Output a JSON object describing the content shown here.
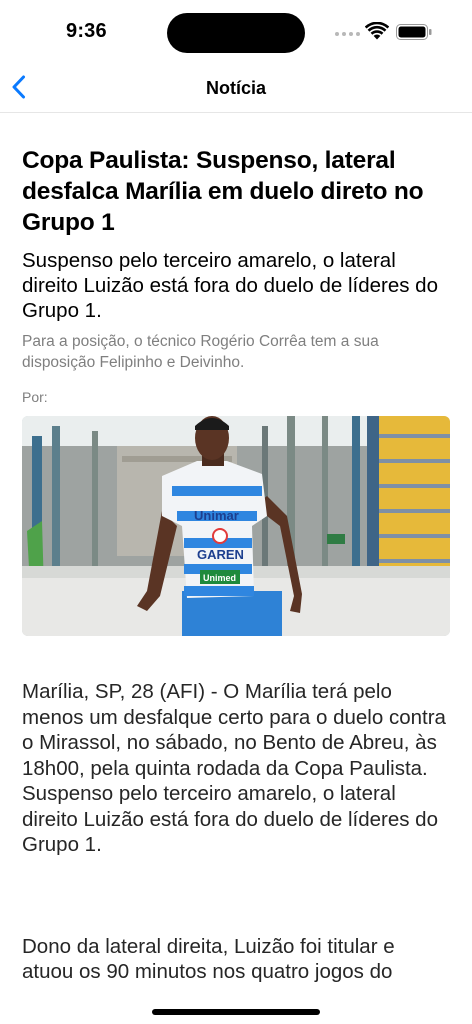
{
  "status": {
    "time": "9:36"
  },
  "icons": {
    "back": "chevron-left-icon",
    "wifi": "wifi-icon",
    "battery": "battery-icon",
    "signal": "cellular-signal-icon"
  },
  "colors": {
    "accent": "#0a7aff",
    "secondary_text": "#7f7f7f",
    "body_text": "#262626"
  },
  "nav": {
    "title": "Notícia"
  },
  "article": {
    "headline": "Copa Paulista: Suspenso, lateral desfalca Marília em duelo direto no Grupo 1",
    "subheadline": "Suspenso pelo terceiro amarelo, o lateral direito Luizão está fora do duelo de líderes do Grupo 1.",
    "summary": "Para a posição, o técnico Rogério Corrêa tem a sua disposição Felipinho e Deivinho.",
    "byline": "Por:",
    "photo": {
      "jersey_sponsor_1": "Unimar",
      "jersey_sponsor_2": "GAREN",
      "jersey_sponsor_3": "Unimed"
    },
    "paragraphs": [
      "Marília, SP, 28 (AFI) - O Marília terá pelo menos um desfalque certo para o duelo contra o Mirassol, no sábado, no Bento de Abreu, às 18h00, pela quinta rodada da Copa Paulista. Suspenso pelo terceiro amarelo, o lateral direito Luizão está fora do duelo de líderes do Grupo 1.",
      "Dono da lateral direita, Luizão foi titular e atuou os 90 minutos nos quatro jogos do"
    ]
  }
}
